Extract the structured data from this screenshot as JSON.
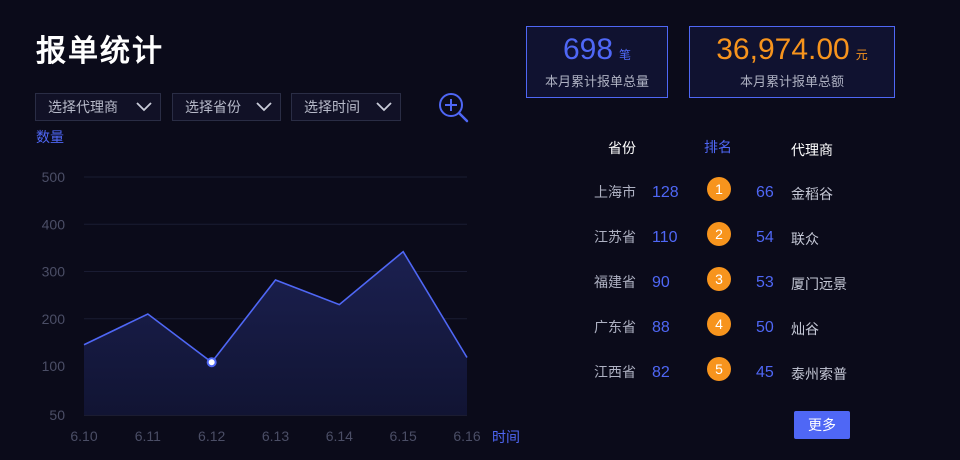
{
  "page": {
    "title": "报单统计"
  },
  "filters": [
    {
      "label": "选择代理商"
    },
    {
      "label": "选择省份"
    },
    {
      "label": "选择时间"
    }
  ],
  "stats": {
    "count": {
      "value": "698",
      "unit": "笔",
      "label": "本月累计报单总量",
      "color": "#4f67f5"
    },
    "amount": {
      "value": "36,974.00",
      "unit": "元",
      "label": "本月累计报单总额",
      "color": "#f7941d"
    }
  },
  "ranking": {
    "headers": {
      "province": "省份",
      "rank": "排名",
      "agent": "代理商"
    },
    "rows": [
      {
        "province": "上海市",
        "province_count": "128",
        "rank": "1",
        "agent_count": "66",
        "agent": "金稻谷"
      },
      {
        "province": "江苏省",
        "province_count": "110",
        "rank": "2",
        "agent_count": "54",
        "agent": "联众"
      },
      {
        "province": "福建省",
        "province_count": "90",
        "rank": "3",
        "agent_count": "53",
        "agent": "厦门远景"
      },
      {
        "province": "广东省",
        "province_count": "88",
        "rank": "4",
        "agent_count": "50",
        "agent": "灿谷"
      },
      {
        "province": "江西省",
        "province_count": "82",
        "rank": "5",
        "agent_count": "45",
        "agent": "泰州索普"
      }
    ],
    "more_label": "更多"
  },
  "chart_data": {
    "type": "area",
    "ylabel": "数量",
    "xlabel": "时间",
    "categories": [
      "6.10",
      "6.11",
      "6.12",
      "6.13",
      "6.14",
      "6.15",
      "6.16"
    ],
    "y_ticks": [
      "500",
      "400",
      "300",
      "200",
      "100",
      "50"
    ],
    "series": [
      {
        "values": [
          145,
          210,
          108,
          282,
          230,
          342,
          118
        ]
      }
    ],
    "highlight_index": 2,
    "line_color": "#4f67f5",
    "grid": true
  }
}
